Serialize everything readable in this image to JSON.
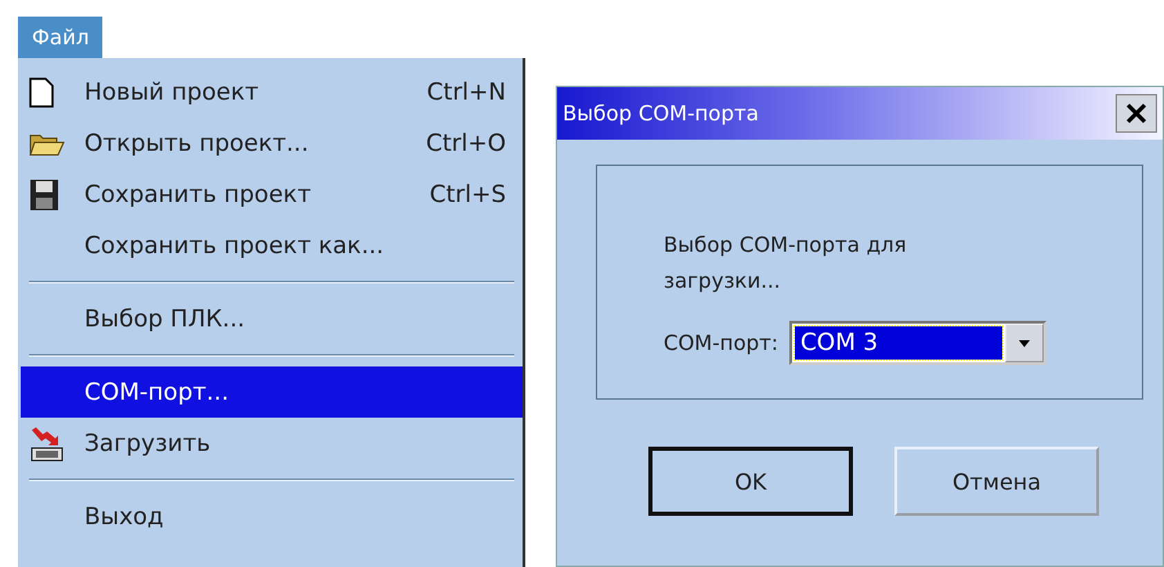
{
  "menu_bar": {
    "title": "Файл"
  },
  "menu": {
    "items": [
      {
        "kind": "item",
        "label": "Новый проект",
        "shortcut": "Ctrl+N",
        "selected": false
      },
      {
        "kind": "item",
        "label": "Открыть проект...",
        "shortcut": "Ctrl+O",
        "selected": false
      },
      {
        "kind": "item",
        "label": "Сохранить проект",
        "shortcut": "Ctrl+S",
        "selected": false
      },
      {
        "kind": "item",
        "label": "Сохранить проект как...",
        "selected": false
      },
      {
        "kind": "separator"
      },
      {
        "kind": "item",
        "label": "Выбор ПЛК...",
        "selected": false
      },
      {
        "kind": "separator"
      },
      {
        "kind": "item",
        "label": "COM-порт...",
        "selected": true
      },
      {
        "kind": "item",
        "label": "Загрузить",
        "selected": false
      },
      {
        "kind": "separator"
      },
      {
        "kind": "item",
        "label": "Выход",
        "selected": false
      }
    ]
  },
  "dialog": {
    "title": "Выбор COM-порта",
    "message": "Выбор COM-порта для загрузки...",
    "combo": {
      "label": "COM-порт:",
      "value": "COM 3"
    },
    "buttons": [
      {
        "label": "OK",
        "default": true
      },
      {
        "label": "Отмена",
        "default": false
      }
    ]
  }
}
